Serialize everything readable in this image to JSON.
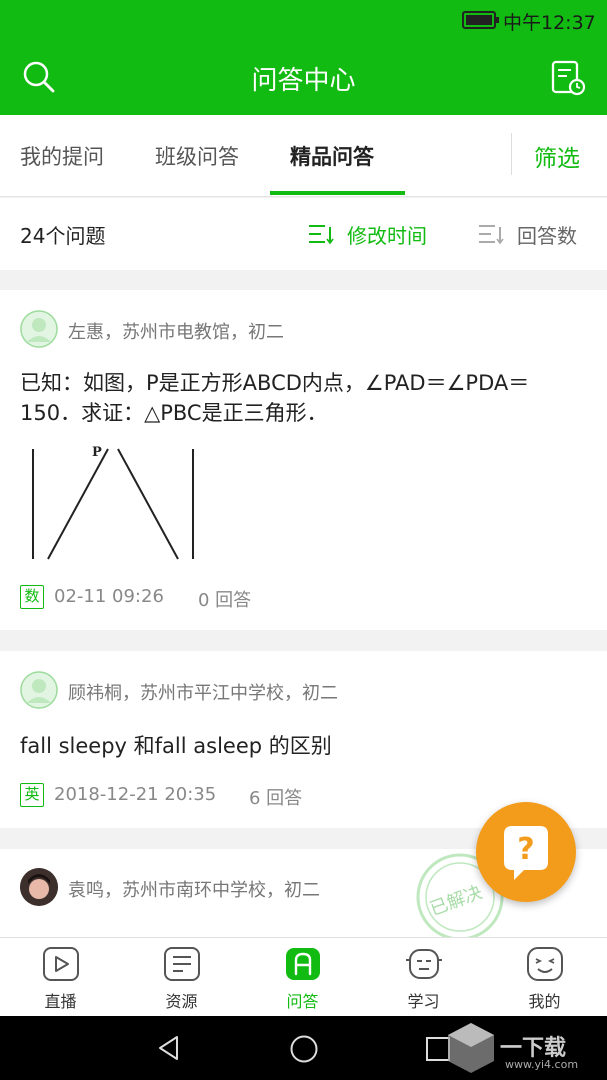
{
  "status_bar": {
    "time": "中午12:37"
  },
  "app_bar": {
    "title": "问答中心"
  },
  "tabs": [
    {
      "label": "我的提问"
    },
    {
      "label": "班级问答"
    },
    {
      "label": "精品问答",
      "active": true
    }
  ],
  "filter_label": "筛选",
  "list_header": {
    "count": "24个问题",
    "sort_options": [
      {
        "label": "修改时间",
        "active": true
      },
      {
        "label": "回答数",
        "active": false
      }
    ]
  },
  "questions": [
    {
      "author_meta": "左惠，苏州市电教馆，初二",
      "text": "已知：如图，P是正方形ABCD内点，∠PAD＝∠PDA＝150．求证：△PBC是正三角形．",
      "figure_label": "P",
      "subject": "数",
      "date": "02-11 09:26",
      "answers": "0 回答"
    },
    {
      "author_meta": "顾祎桐，苏州市平江中学校，初二",
      "text": "fall sleepy 和fall asleep 的区别",
      "subject": "英",
      "date": "2018-12-21 20:35",
      "answers": "6 回答"
    },
    {
      "author_meta": "袁鸣，苏州市南环中学校，初二",
      "stamp": "已解决"
    }
  ],
  "fab": {
    "label": "?"
  },
  "bottom_nav": [
    {
      "label": "直播",
      "icon": "video-icon"
    },
    {
      "label": "资源",
      "icon": "document-icon"
    },
    {
      "label": "问答",
      "icon": "qa-icon",
      "active": true
    },
    {
      "label": "学习",
      "icon": "robot-icon"
    },
    {
      "label": "我的",
      "icon": "smiley-icon"
    }
  ],
  "watermark": {
    "title": "一下载",
    "url": "www.yi4.com"
  },
  "colors": {
    "primary": "#12bb12",
    "fab": "#f39c1c"
  }
}
